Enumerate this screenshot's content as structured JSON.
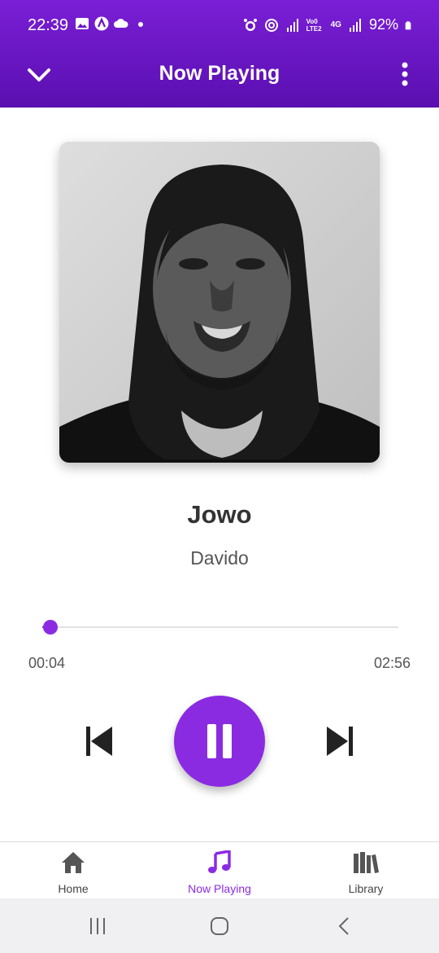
{
  "status_bar": {
    "time": "22:39",
    "battery": "92%",
    "network_label": "Vo0 LTE2",
    "network_type": "4G",
    "left_icons": [
      "image-icon",
      "app-icon",
      "cloud-icon",
      "dot-icon"
    ],
    "right_icons": [
      "alarm-icon",
      "hotspot-icon",
      "signal-icon",
      "signal-icon",
      "battery-icon"
    ]
  },
  "header": {
    "title": "Now Playing",
    "back_icon": "chevron-down-icon",
    "menu_icon": "more-vertical-icon"
  },
  "track": {
    "title": "Jowo",
    "artist": "Davido",
    "current_time": "00:04",
    "duration": "02:56",
    "progress_fraction": 0.023
  },
  "controls": {
    "prev_icon": "skip-previous-icon",
    "play_icon": "pause-icon",
    "next_icon": "skip-next-icon"
  },
  "bottom_nav": {
    "items": [
      {
        "label": "Home",
        "icon": "home-icon",
        "active": false
      },
      {
        "label": "Now Playing",
        "icon": "music-note-icon",
        "active": true
      },
      {
        "label": "Library",
        "icon": "library-icon",
        "active": false
      }
    ]
  },
  "colors": {
    "accent": "#8a2be2",
    "header_top": "#7a1fd6",
    "header_bottom": "#5a0fb0",
    "inactive_nav": "#444444"
  }
}
